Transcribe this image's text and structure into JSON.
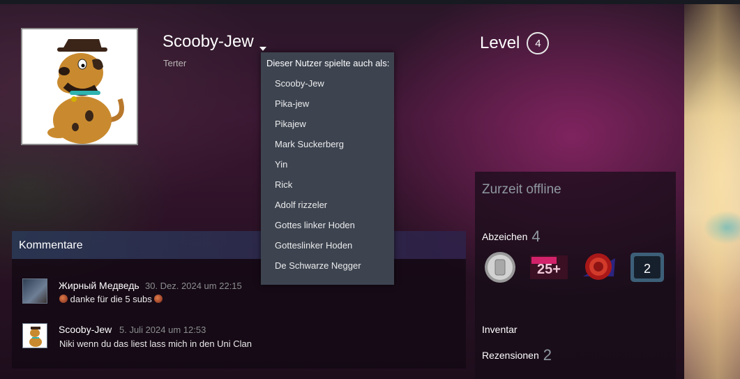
{
  "profile": {
    "persona_name": "Scooby-Jew",
    "real_name": "Terter",
    "level_label": "Level",
    "level_value": "4"
  },
  "alias_dropdown": {
    "header": "Dieser Nutzer spielte auch als:",
    "items": [
      "Scooby-Jew",
      "Pika-jew",
      "Pikajew",
      "Mark Suckerberg",
      "Yin",
      "Rick",
      "Adolf rizzeler",
      "Gottes linker Hoden",
      "Gotteslinker Hoden",
      "De Schwarze Negger"
    ]
  },
  "comments": {
    "title": "Kommentare",
    "items": [
      {
        "author": "Жирный Медведь",
        "time": "30. Dez. 2024 um 22:15",
        "text": "danke für die 5 subs"
      },
      {
        "author": "Scooby-Jew",
        "time": "5. Juli 2024 um 12:53",
        "text": "Niki wenn du das liest lass mich in den Uni Clan"
      }
    ]
  },
  "sidebar": {
    "status": "Zurzeit offline",
    "badges_label": "Abzeichen",
    "badges_count": "4",
    "badge_icons": [
      "silver-coin-badge-icon",
      "25-plus-badge-icon",
      "red-seal-badge-icon",
      "level-2-badge-icon"
    ],
    "badge_2_text": "25+",
    "badge_4_text": "2",
    "inventory_label": "Inventar",
    "reviews_label": "Rezensionen",
    "reviews_count": "2"
  },
  "colors": {
    "dropdown_bg": "#3d4450",
    "status_text": "#8f98a0",
    "accent_link": "#ffffff"
  }
}
